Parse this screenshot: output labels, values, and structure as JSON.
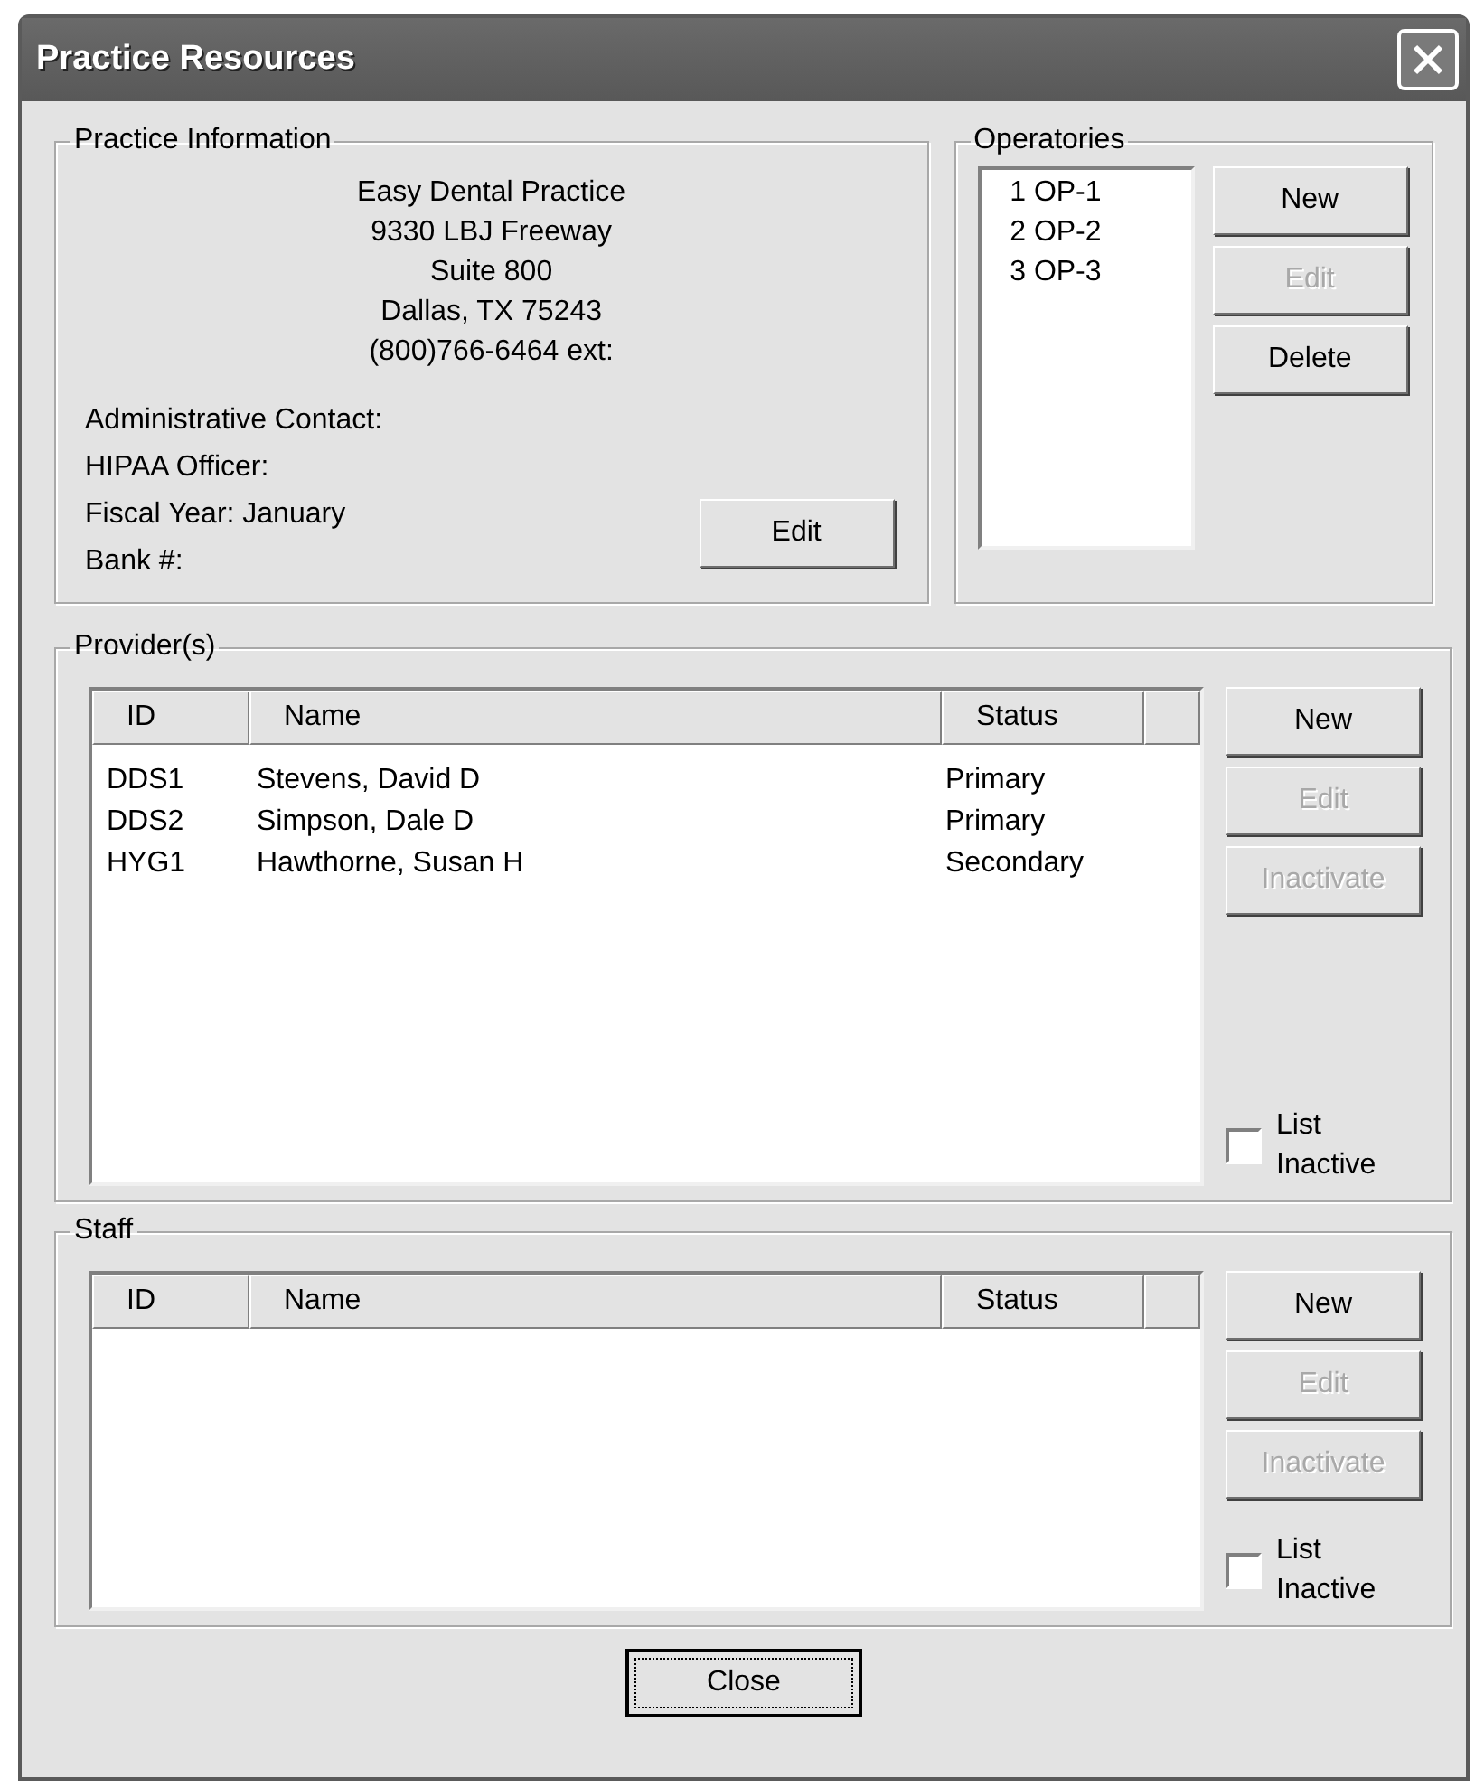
{
  "window": {
    "title": "Practice Resources"
  },
  "practice_info": {
    "legend": "Practice Information",
    "address_lines": [
      "Easy Dental Practice",
      "9330 LBJ Freeway",
      "Suite 800",
      "Dallas, TX  75243",
      "(800)766-6464 ext:"
    ],
    "fields": [
      "Administrative Contact:",
      "HIPAA Officer:",
      "Fiscal Year: January",
      "Bank #:"
    ],
    "edit_button": {
      "label": "Edit",
      "disabled": false
    }
  },
  "operatories": {
    "legend": "Operatories",
    "items": [
      {
        "number": "1",
        "name": "OP-1",
        "selected": false
      },
      {
        "number": "2",
        "name": "OP-2",
        "selected": false
      },
      {
        "number": "3",
        "name": "OP-3",
        "selected": false
      }
    ],
    "buttons": [
      {
        "label": "New",
        "disabled": false
      },
      {
        "label": "Edit",
        "disabled": true
      },
      {
        "label": "Delete",
        "disabled": false
      }
    ]
  },
  "providers": {
    "legend": "Provider(s)",
    "columns": [
      "ID",
      "Name",
      "Status"
    ],
    "rows": [
      {
        "id": "DDS1",
        "name": "Stevens, David D",
        "status": "Primary",
        "selected": false
      },
      {
        "id": "DDS2",
        "name": "Simpson, Dale D",
        "status": "Primary",
        "selected": false
      },
      {
        "id": "HYG1",
        "name": "Hawthorne, Susan H",
        "status": "Secondary",
        "selected": false
      }
    ],
    "buttons": [
      {
        "label": "New",
        "disabled": false
      },
      {
        "label": "Edit",
        "disabled": true
      },
      {
        "label": "Inactivate",
        "disabled": true
      }
    ],
    "list_inactive": {
      "label": "List Inactive",
      "checked": false
    }
  },
  "staff": {
    "legend": "Staff",
    "columns": [
      "ID",
      "Name",
      "Status"
    ],
    "buttons": [
      {
        "label": "New",
        "disabled": false
      },
      {
        "label": "Edit",
        "disabled": true
      },
      {
        "label": "Inactivate",
        "disabled": true
      }
    ],
    "list_inactive": {
      "label": "List Inactive",
      "checked": false
    }
  },
  "close_button": {
    "label": "Close"
  }
}
